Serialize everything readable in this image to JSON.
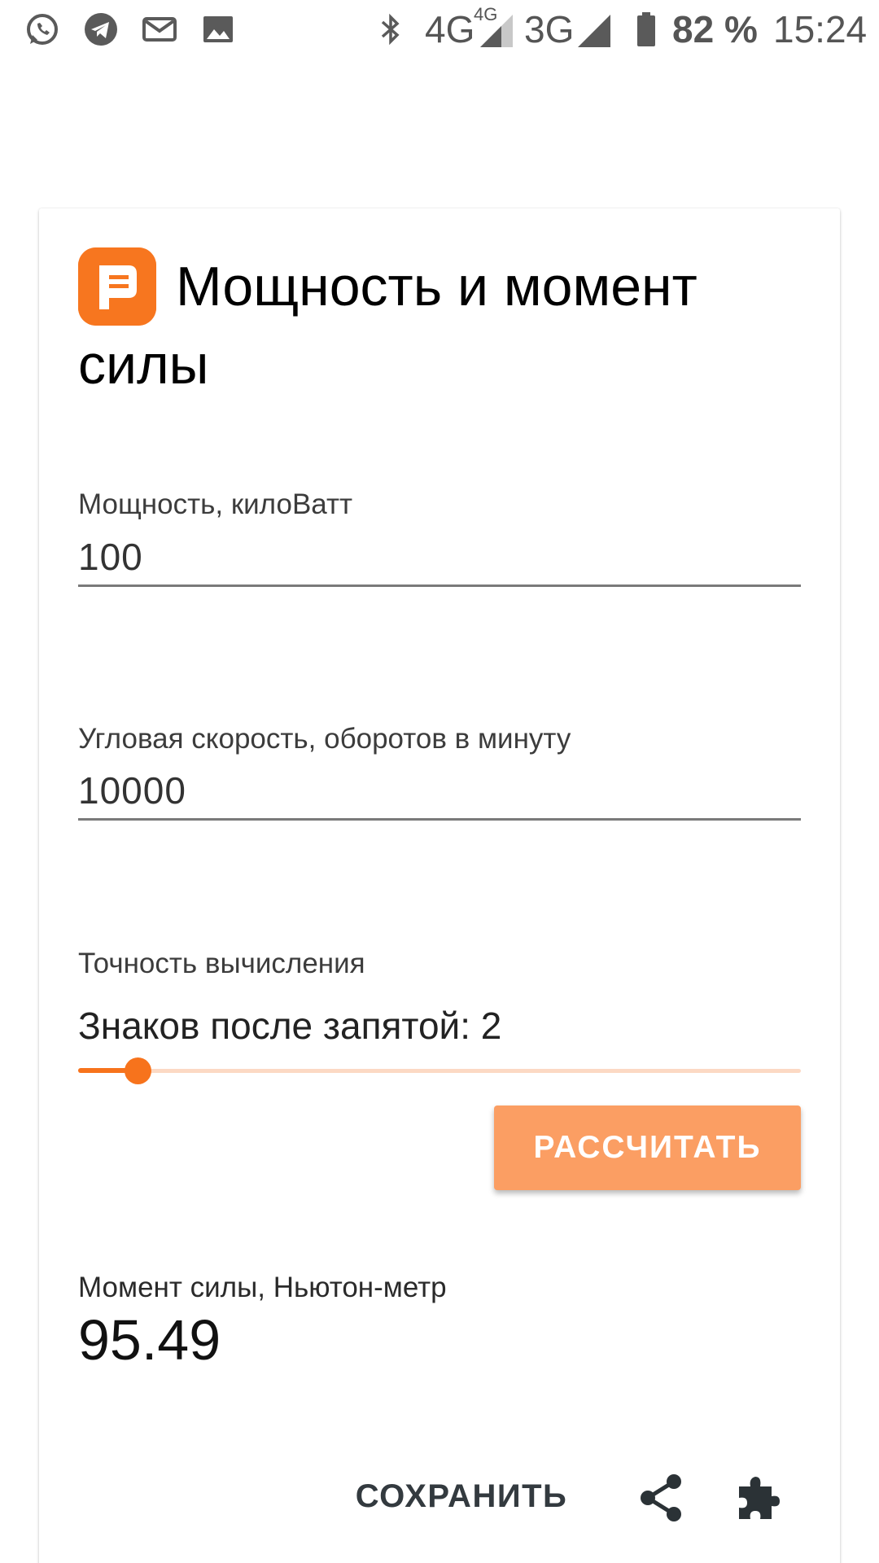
{
  "status_bar": {
    "icons": [
      "whatsapp-icon",
      "telegram-icon",
      "mail-icon",
      "image-icon",
      "bluetooth-icon",
      "signal-icon",
      "battery-icon"
    ],
    "network_1": "4G",
    "network_1_sup": "4G",
    "network_2": "3G",
    "battery": "82 %",
    "time": "15:24"
  },
  "header": {
    "logo_icon": "calculator-p-logo-icon",
    "title": "Мощность и момент силы"
  },
  "form": {
    "power": {
      "label": "Мощность, килоВатт",
      "value": "100"
    },
    "speed": {
      "label": "Угловая скорость, оборотов в минуту",
      "value": "10000"
    },
    "precision": {
      "label": "Точность вычисления",
      "value_text": "Знаков после запятой: 2",
      "slider_fraction": 0.082
    },
    "calculate_label": "РАССЧИТАТЬ"
  },
  "result": {
    "label": "Момент силы, Ньютон-метр",
    "value": "95.49"
  },
  "actions": {
    "save_label": "СОХРАНИТЬ",
    "share_icon": "share-icon",
    "extension_icon": "puzzle-icon"
  },
  "colors": {
    "accent": "#f7731c",
    "button": "#fb9e63",
    "track": "#fcd9c4",
    "logo": "#f7761f"
  }
}
